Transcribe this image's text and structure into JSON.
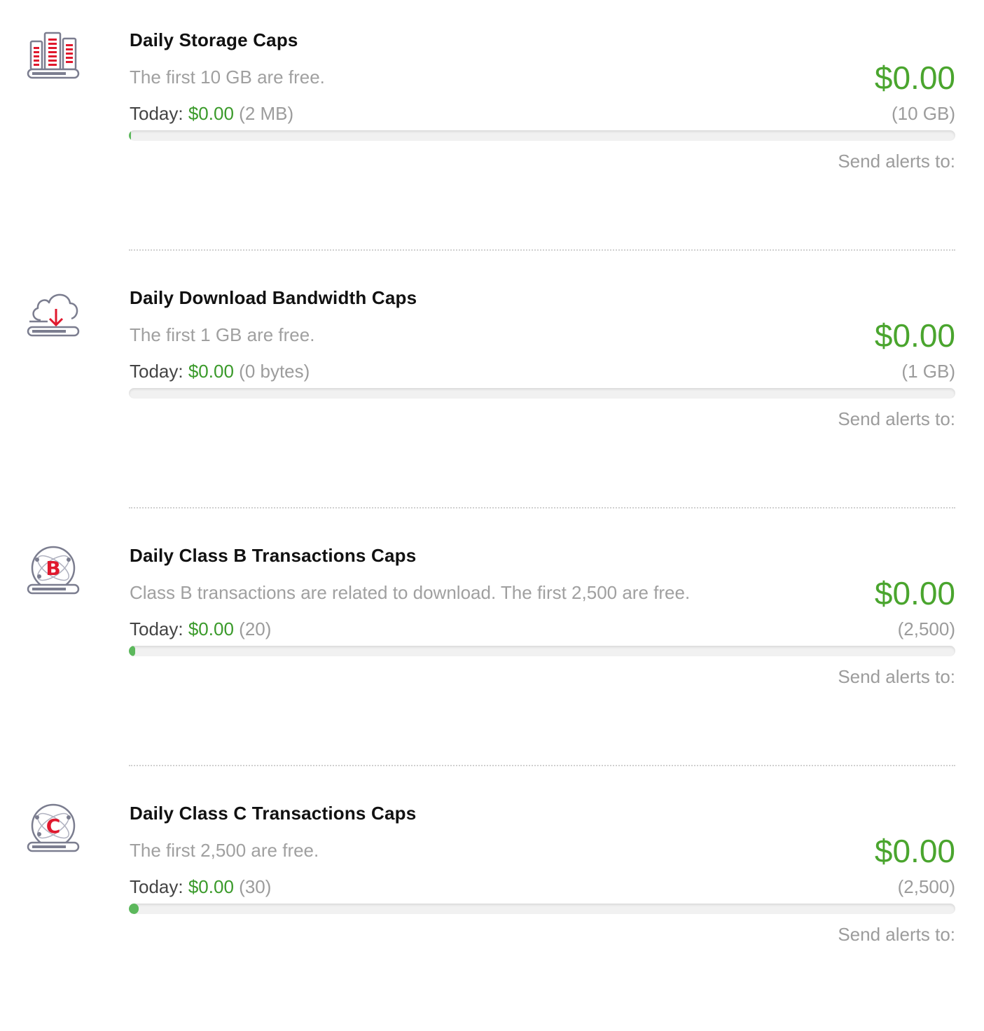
{
  "caps": [
    {
      "title": "Daily Storage Caps",
      "description": "The first 10 GB are free.",
      "today_label": "Today:",
      "today_cost": "$0.00",
      "today_usage": "(2 MB)",
      "price": "$0.00",
      "limit": "(10 GB)",
      "usage_fraction": 0.002,
      "alerts_label": "Send alerts to:",
      "icon": "storage-icon"
    },
    {
      "title": "Daily Download Bandwidth Caps",
      "description": "The first 1 GB are free.",
      "today_label": "Today:",
      "today_cost": "$0.00",
      "today_usage": "(0 bytes)",
      "price": "$0.00",
      "limit": "(1 GB)",
      "usage_fraction": 0,
      "alerts_label": "Send alerts to:",
      "icon": "cloud-download-icon"
    },
    {
      "title": "Daily Class B Transactions Caps",
      "description": "Class B transactions are related to download. The first 2,500 are free.",
      "today_label": "Today:",
      "today_cost": "$0.00",
      "today_usage": "(20)",
      "price": "$0.00",
      "limit": "(2,500)",
      "usage_fraction": 0.008,
      "alerts_label": "Send alerts to:",
      "icon": "class-b-transactions-icon",
      "icon_letter": "B"
    },
    {
      "title": "Daily Class C Transactions Caps",
      "description": "The first 2,500 are free.",
      "today_label": "Today:",
      "today_cost": "$0.00",
      "today_usage": "(30)",
      "price": "$0.00",
      "limit": "(2,500)",
      "usage_fraction": 0.012,
      "alerts_label": "Send alerts to:",
      "icon": "class-c-transactions-icon",
      "icon_letter": "C"
    }
  ],
  "colors": {
    "accent_green": "#4aa52e",
    "progress_fill": "#5cb85c",
    "icon_red": "#e0182d",
    "icon_gray": "#7b7d8f"
  }
}
